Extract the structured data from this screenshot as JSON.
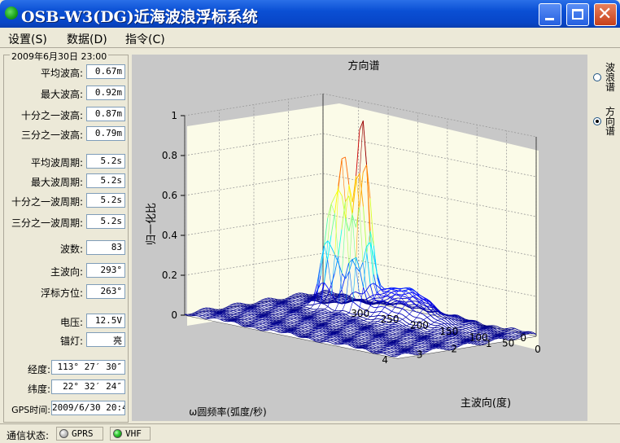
{
  "window": {
    "title": "OSB-W3(DG)近海波浪浮标系统"
  },
  "menu": [
    {
      "label": "设置(S)"
    },
    {
      "label": "数据(D)"
    },
    {
      "label": "指令(C)"
    }
  ],
  "group": {
    "datetime": "2009年6月30日 23:00"
  },
  "fields": [
    {
      "label": "平均波高:",
      "value": "0.67m"
    },
    {
      "label": "最大波高:",
      "value": "0.92m"
    },
    {
      "label": "十分之一波高:",
      "value": "0.87m"
    },
    {
      "label": "三分之一波高:",
      "value": "0.79m"
    },
    {
      "label": "平均波周期:",
      "value": "5.2s"
    },
    {
      "label": "最大波周期:",
      "value": "5.2s"
    },
    {
      "label": "十分之一波周期:",
      "value": "5.2s"
    },
    {
      "label": "三分之一波周期:",
      "value": "5.2s"
    },
    {
      "label": "波数:",
      "value": "83"
    },
    {
      "label": "主波向:",
      "value": "293°"
    },
    {
      "label": "浮标方位:",
      "value": "263°"
    },
    {
      "label": "电压:",
      "value": "12.5V"
    },
    {
      "label": "锚灯:",
      "value": "亮"
    },
    {
      "label": "经度:",
      "value": "113° 27′ 30″"
    },
    {
      "label": "纬度:",
      "value": "22° 32′ 24″"
    },
    {
      "label": "GPS时间:",
      "value": "2009/6/30 20:4"
    }
  ],
  "radios": [
    {
      "label": "波浪谱",
      "selected": false
    },
    {
      "label": "方向谱",
      "selected": true
    }
  ],
  "status": {
    "label": "通信状态:",
    "items": [
      {
        "text": "GPRS",
        "state": "off"
      },
      {
        "text": "VHF",
        "state": "on"
      }
    ]
  },
  "chart_data": {
    "type": "surface3d",
    "title": "方向谱",
    "xlabel": "ω圆频率(弧度/秒)",
    "ylabel": "主波向(度)",
    "zlabel": "归一化比",
    "x_ticks": [
      "0",
      "1",
      "2",
      "3",
      "4"
    ],
    "y_ticks": [
      "0",
      "50",
      "100",
      "150",
      "200",
      "250",
      "300"
    ],
    "z_ticks": [
      "0",
      "0.2",
      "0.4",
      "0.6",
      "0.8",
      "1"
    ],
    "xlim": [
      0,
      4
    ],
    "ylim": [
      0,
      360
    ],
    "zlim": [
      0,
      1
    ],
    "peaks": [
      {
        "omega": 1.1,
        "direction": 230,
        "value": 0.92
      },
      {
        "omega": 1.1,
        "direction": 260,
        "value": 0.72
      },
      {
        "omega": 1.2,
        "direction": 280,
        "value": 0.4
      }
    ],
    "grid": true,
    "colormap": "jet"
  }
}
